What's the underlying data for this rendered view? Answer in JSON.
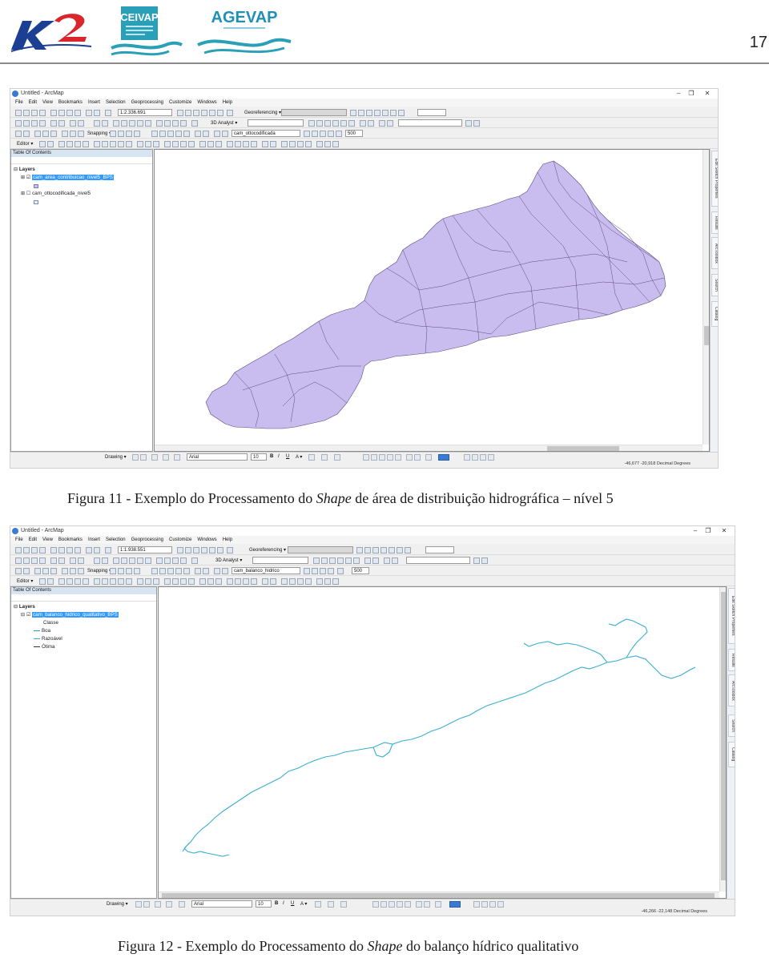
{
  "header": {
    "logos": [
      {
        "name": "K2"
      },
      {
        "name": "CEIVAP"
      },
      {
        "name": "AGEVAP"
      }
    ],
    "page_number": "17"
  },
  "figure11": {
    "window_title": "Untitled - ArcMap",
    "menu": [
      "File",
      "Edit",
      "View",
      "Bookmarks",
      "Insert",
      "Selection",
      "Geoprocessing",
      "Customize",
      "Windows",
      "Help"
    ],
    "scale": "1:2.336.691",
    "georeferencing_label": "Georeferencing ▾",
    "analyst_label": "3D Analyst ▾",
    "snapping_label": "Snapping ▾",
    "layer_combo": "cam_ottocodificada",
    "number_value": "500",
    "editor_label": "Editor ▾",
    "toc_title": "Table Of Contents",
    "toc_root": "Layers",
    "layers": [
      {
        "name": "cam_area_contribuicao_nivel5_BPS",
        "checked": true,
        "selected": true,
        "swatch": "#cbbff0"
      },
      {
        "name": "cam_ottocodificada_nivel5",
        "checked": false,
        "selected": false,
        "swatch": "#e8efff"
      }
    ],
    "dock_tabs": [
      "Edit Sketch Properties",
      "Results",
      "ArcToolbox",
      "Search",
      "Catalog"
    ],
    "drawing_label": "Drawing ▾",
    "font_combo": "Arial",
    "font_size": "10",
    "status_coords": "-46,677  -20,918 Decimal Degrees",
    "fill_color": "#c9bdf0",
    "outline_color": "#5a4a7a"
  },
  "caption11": {
    "prefix": "Figura 11 - Exemplo do Processamento do ",
    "italic": "Shape",
    "suffix": " de área de distribuição hidrográfica – nível 5"
  },
  "figure12": {
    "window_title": "Untitled - ArcMap",
    "menu": [
      "File",
      "Edit",
      "View",
      "Bookmarks",
      "Insert",
      "Selection",
      "Geoprocessing",
      "Customize",
      "Windows",
      "Help"
    ],
    "scale": "1:1.938.551",
    "georeferencing_label": "Georeferencing ▾",
    "analyst_label": "3D Analyst ▾",
    "snapping_label": "Snapping ▾",
    "layer_combo": "cam_balanco_hidrico",
    "number_value": "500",
    "editor_label": "Editor ▾",
    "toc_title": "Table Of Contents",
    "toc_root": "Layers",
    "layer_name": "cam_balanco_hidrico_qualitativo_BPS",
    "legend_heading": "Classe",
    "legend": [
      {
        "label": "Boa",
        "color": "#3a8fc9"
      },
      {
        "label": "Razoável",
        "color": "#3ab0c9"
      },
      {
        "label": "Ótima",
        "color": "#333333"
      }
    ],
    "dock_tabs": [
      "Edit Sketch Properties",
      "Results",
      "ArcToolbox",
      "Search",
      "Catalog"
    ],
    "drawing_label": "Drawing ▾",
    "font_combo": "Arial",
    "font_size": "10",
    "status_coords": "-46,266  -22,148 Decimal Degrees",
    "river_color": "#3aaed0"
  },
  "caption12": {
    "prefix": "Figura 12 - Exemplo do Processamento do ",
    "italic": "Shape",
    "suffix": " do balanço hídrico qualitativo"
  }
}
